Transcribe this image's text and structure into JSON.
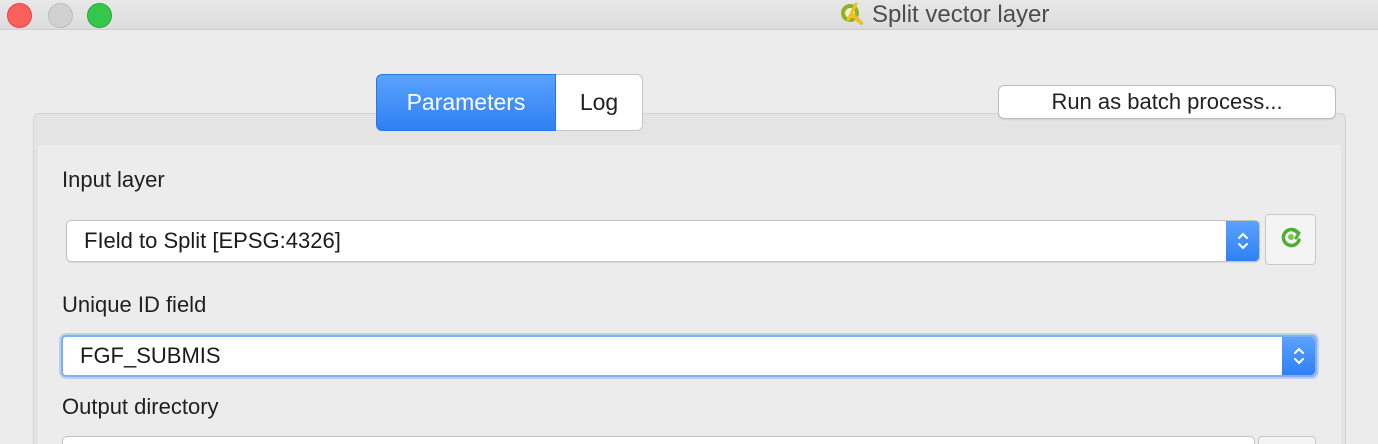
{
  "window": {
    "title": "Split vector layer",
    "icon": "qgis-icon"
  },
  "tabs": [
    {
      "label": "Parameters",
      "active": true
    },
    {
      "label": "Log",
      "active": false
    }
  ],
  "batch_button": {
    "label": "Run as batch process..."
  },
  "form": {
    "input_layer": {
      "label": "Input layer",
      "value": "FIeld to Split [EPSG:4326]",
      "iterate_icon": "iterate-refresh-icon"
    },
    "unique_id": {
      "label": "Unique ID field",
      "value": "FGF_SUBMIS"
    },
    "output_directory": {
      "label": "Output directory"
    }
  },
  "colors": {
    "accent": "#2f80f5",
    "close": "#fc605c",
    "maximize": "#34c749"
  }
}
